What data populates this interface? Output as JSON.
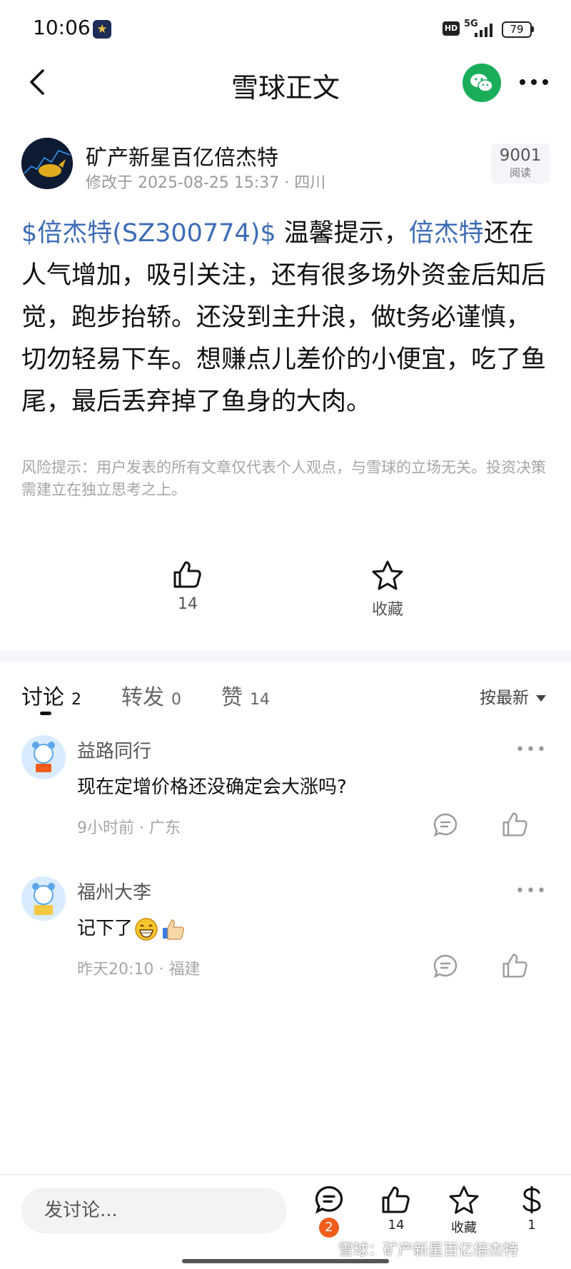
{
  "status_bar": {
    "time": "10:06",
    "hd": "HD",
    "network": "5G",
    "battery": "79"
  },
  "header": {
    "title": "雪球正文"
  },
  "post": {
    "author": "矿产新星百亿倍杰特",
    "meta": "修改于 2025-08-25 15:37 · 四川",
    "read_count": "9001",
    "read_label": "阅读",
    "stock_tag": "$倍杰特(SZ300774)$",
    "body_part1": " 温馨提示，",
    "stock_link": "倍杰特",
    "body_part2": "还在人气增加，吸引关注，还有很多场外资金后知后觉，跑步抬轿。还没到主升浪，做t务必谨慎，切勿轻易下车。想赚点儿差价的小便宜，吃了鱼尾，最后丢弃掉了鱼身的大肉。",
    "risk_notice": "风险提示：用户发表的所有文章仅代表个人观点，与雪球的立场无关。投资决策需建立在独立思考之上。"
  },
  "actions": {
    "like_count": "14",
    "favorite_label": "收藏"
  },
  "tabs": [
    {
      "label": "讨论",
      "count": "2"
    },
    {
      "label": "转发",
      "count": "0"
    },
    {
      "label": "赞",
      "count": "14"
    }
  ],
  "sort": {
    "label": "按最新"
  },
  "comments": [
    {
      "user": "益路同行",
      "text": "现在定增价格还没确定会大涨吗?",
      "meta": "9小时前 · 广东"
    },
    {
      "user": "福州大李",
      "text": "记下了",
      "meta": "昨天20:10 · 福建"
    }
  ],
  "bottom_bar": {
    "input_placeholder": "发讨论...",
    "comment_badge": "2",
    "like_count": "14",
    "favorite_label": "收藏",
    "reward_count": "1"
  },
  "watermark": "雪球：矿产新星百亿倍杰特"
}
